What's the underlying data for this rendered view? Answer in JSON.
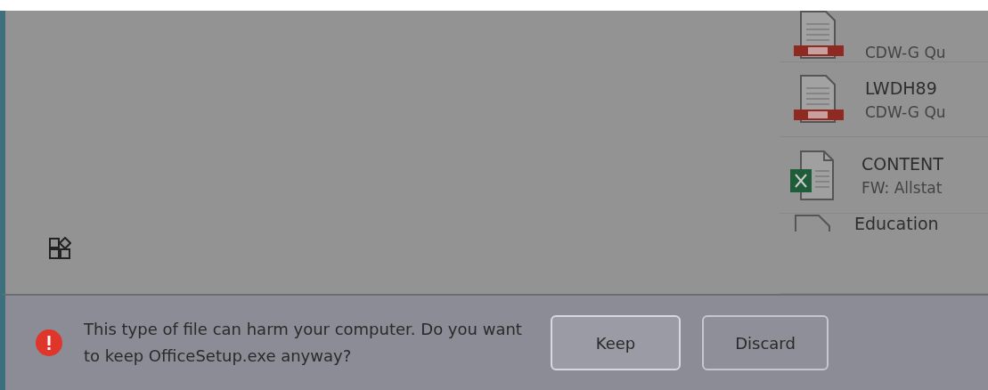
{
  "files": [
    {
      "kind": "pdf",
      "subtitle": "CDW-G Qu"
    },
    {
      "kind": "pdf",
      "title": "LWDH89",
      "subtitle": "CDW-G Qu"
    },
    {
      "kind": "excel",
      "title": "CONTENT",
      "subtitle": "FW: Allstat"
    },
    {
      "kind": "blank",
      "title": "Education"
    }
  ],
  "download_warning": {
    "message": "This type of file can harm your computer. Do you want to keep OfficeSetup.exe anyway?",
    "buttons": [
      {
        "label": "Keep",
        "selected": true
      },
      {
        "label": "Discard",
        "selected": false
      }
    ]
  }
}
